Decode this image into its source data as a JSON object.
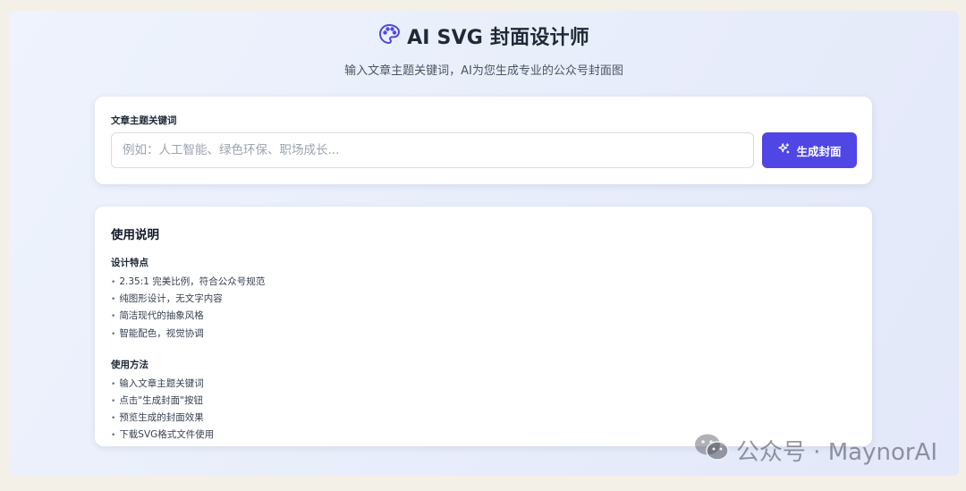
{
  "app": {
    "title": "AI SVG 封面设计师",
    "subtitle": "输入文章主题关键词，AI为您生成专业的公众号封面图",
    "title_icon": "palette-icon",
    "accent_color": "#4f46e5"
  },
  "form": {
    "label": "文章主题关键词",
    "placeholder": "例如：人工智能、绿色环保、职场成长...",
    "value": "",
    "button_label": "生成封面",
    "button_icon": "sparkles-icon"
  },
  "help": {
    "title": "使用说明",
    "features_title": "设计特点",
    "features": [
      "2.35:1 完美比例，符合公众号规范",
      "纯图形设计，无文字内容",
      "简洁现代的抽象风格",
      "智能配色，视觉协调"
    ],
    "usage_title": "使用方法",
    "usage": [
      "输入文章主题关键词",
      "点击\"生成封面\"按钮",
      "预览生成的封面效果",
      "下载SVG格式文件使用"
    ]
  },
  "watermark": {
    "text": "公众号 · MaynorAI",
    "icon": "wechat-icon"
  }
}
